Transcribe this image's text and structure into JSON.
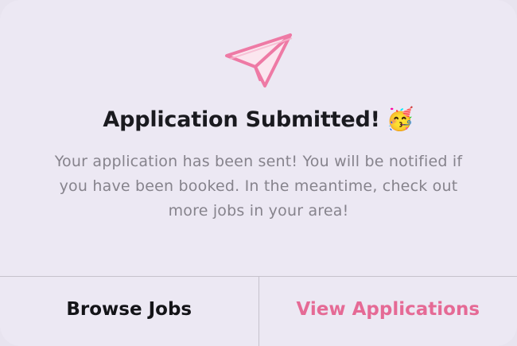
{
  "dialog": {
    "icon": "paper-plane-icon",
    "title": "Application Submitted!",
    "title_emoji": "🥳",
    "message": "Your application has been sent! You will be notified if you have been booked. In the meantime, check out more jobs in your area!",
    "actions": {
      "browse_label": "Browse Jobs",
      "view_label": "View Applications"
    }
  },
  "colors": {
    "background": "#ece8f3",
    "accent": "#e56a95",
    "title": "#1a1a1f",
    "message": "#86838c",
    "divider": "#c6c2cc"
  }
}
